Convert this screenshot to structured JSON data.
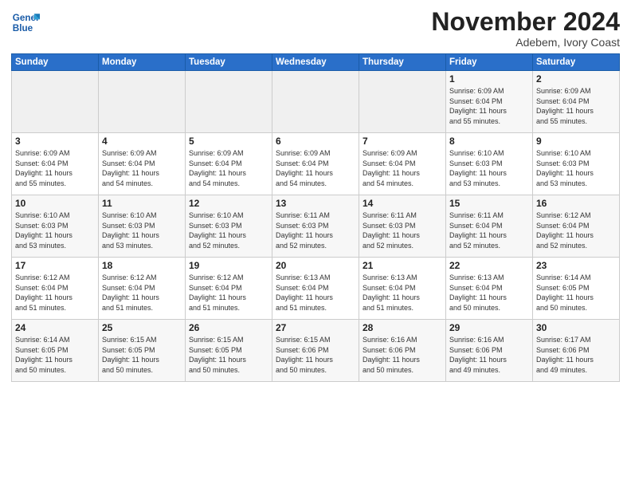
{
  "header": {
    "logo_line1": "General",
    "logo_line2": "Blue",
    "month_title": "November 2024",
    "location": "Adebem, Ivory Coast"
  },
  "days_of_week": [
    "Sunday",
    "Monday",
    "Tuesday",
    "Wednesday",
    "Thursday",
    "Friday",
    "Saturday"
  ],
  "weeks": [
    [
      {
        "day": "",
        "info": ""
      },
      {
        "day": "",
        "info": ""
      },
      {
        "day": "",
        "info": ""
      },
      {
        "day": "",
        "info": ""
      },
      {
        "day": "",
        "info": ""
      },
      {
        "day": "1",
        "info": "Sunrise: 6:09 AM\nSunset: 6:04 PM\nDaylight: 11 hours\nand 55 minutes."
      },
      {
        "day": "2",
        "info": "Sunrise: 6:09 AM\nSunset: 6:04 PM\nDaylight: 11 hours\nand 55 minutes."
      }
    ],
    [
      {
        "day": "3",
        "info": "Sunrise: 6:09 AM\nSunset: 6:04 PM\nDaylight: 11 hours\nand 55 minutes."
      },
      {
        "day": "4",
        "info": "Sunrise: 6:09 AM\nSunset: 6:04 PM\nDaylight: 11 hours\nand 54 minutes."
      },
      {
        "day": "5",
        "info": "Sunrise: 6:09 AM\nSunset: 6:04 PM\nDaylight: 11 hours\nand 54 minutes."
      },
      {
        "day": "6",
        "info": "Sunrise: 6:09 AM\nSunset: 6:04 PM\nDaylight: 11 hours\nand 54 minutes."
      },
      {
        "day": "7",
        "info": "Sunrise: 6:09 AM\nSunset: 6:04 PM\nDaylight: 11 hours\nand 54 minutes."
      },
      {
        "day": "8",
        "info": "Sunrise: 6:10 AM\nSunset: 6:03 PM\nDaylight: 11 hours\nand 53 minutes."
      },
      {
        "day": "9",
        "info": "Sunrise: 6:10 AM\nSunset: 6:03 PM\nDaylight: 11 hours\nand 53 minutes."
      }
    ],
    [
      {
        "day": "10",
        "info": "Sunrise: 6:10 AM\nSunset: 6:03 PM\nDaylight: 11 hours\nand 53 minutes."
      },
      {
        "day": "11",
        "info": "Sunrise: 6:10 AM\nSunset: 6:03 PM\nDaylight: 11 hours\nand 53 minutes."
      },
      {
        "day": "12",
        "info": "Sunrise: 6:10 AM\nSunset: 6:03 PM\nDaylight: 11 hours\nand 52 minutes."
      },
      {
        "day": "13",
        "info": "Sunrise: 6:11 AM\nSunset: 6:03 PM\nDaylight: 11 hours\nand 52 minutes."
      },
      {
        "day": "14",
        "info": "Sunrise: 6:11 AM\nSunset: 6:03 PM\nDaylight: 11 hours\nand 52 minutes."
      },
      {
        "day": "15",
        "info": "Sunrise: 6:11 AM\nSunset: 6:04 PM\nDaylight: 11 hours\nand 52 minutes."
      },
      {
        "day": "16",
        "info": "Sunrise: 6:12 AM\nSunset: 6:04 PM\nDaylight: 11 hours\nand 52 minutes."
      }
    ],
    [
      {
        "day": "17",
        "info": "Sunrise: 6:12 AM\nSunset: 6:04 PM\nDaylight: 11 hours\nand 51 minutes."
      },
      {
        "day": "18",
        "info": "Sunrise: 6:12 AM\nSunset: 6:04 PM\nDaylight: 11 hours\nand 51 minutes."
      },
      {
        "day": "19",
        "info": "Sunrise: 6:12 AM\nSunset: 6:04 PM\nDaylight: 11 hours\nand 51 minutes."
      },
      {
        "day": "20",
        "info": "Sunrise: 6:13 AM\nSunset: 6:04 PM\nDaylight: 11 hours\nand 51 minutes."
      },
      {
        "day": "21",
        "info": "Sunrise: 6:13 AM\nSunset: 6:04 PM\nDaylight: 11 hours\nand 51 minutes."
      },
      {
        "day": "22",
        "info": "Sunrise: 6:13 AM\nSunset: 6:04 PM\nDaylight: 11 hours\nand 50 minutes."
      },
      {
        "day": "23",
        "info": "Sunrise: 6:14 AM\nSunset: 6:05 PM\nDaylight: 11 hours\nand 50 minutes."
      }
    ],
    [
      {
        "day": "24",
        "info": "Sunrise: 6:14 AM\nSunset: 6:05 PM\nDaylight: 11 hours\nand 50 minutes."
      },
      {
        "day": "25",
        "info": "Sunrise: 6:15 AM\nSunset: 6:05 PM\nDaylight: 11 hours\nand 50 minutes."
      },
      {
        "day": "26",
        "info": "Sunrise: 6:15 AM\nSunset: 6:05 PM\nDaylight: 11 hours\nand 50 minutes."
      },
      {
        "day": "27",
        "info": "Sunrise: 6:15 AM\nSunset: 6:06 PM\nDaylight: 11 hours\nand 50 minutes."
      },
      {
        "day": "28",
        "info": "Sunrise: 6:16 AM\nSunset: 6:06 PM\nDaylight: 11 hours\nand 50 minutes."
      },
      {
        "day": "29",
        "info": "Sunrise: 6:16 AM\nSunset: 6:06 PM\nDaylight: 11 hours\nand 49 minutes."
      },
      {
        "day": "30",
        "info": "Sunrise: 6:17 AM\nSunset: 6:06 PM\nDaylight: 11 hours\nand 49 minutes."
      }
    ]
  ]
}
